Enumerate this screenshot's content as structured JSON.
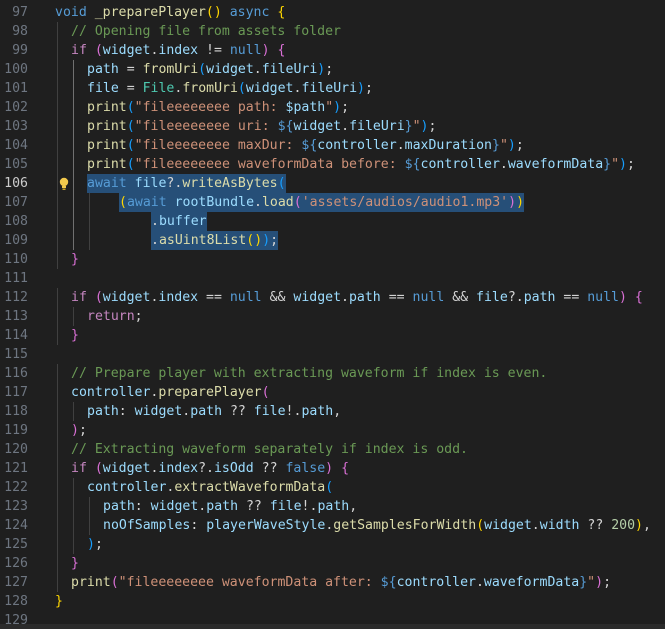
{
  "editor": {
    "language": "dart",
    "active_line": 106,
    "colors": {
      "background": "#1f1f1f",
      "selection": "#264f78",
      "keyword": "#569cd6",
      "control": "#c586c0",
      "function": "#dcdcaa",
      "variable": "#9cdcfe",
      "type": "#4ec9b0",
      "string": "#ce9178",
      "comment": "#6a9955",
      "number": "#b5cea8"
    },
    "lightbulb_icon": "lightbulb-icon",
    "lines": [
      {
        "n": "97",
        "tokens": [
          [
            "k",
            "void"
          ],
          [
            "o",
            " "
          ],
          [
            "f",
            "_preparePlayer"
          ],
          [
            "b1",
            "()"
          ],
          [
            "o",
            " "
          ],
          [
            "k",
            "async"
          ],
          [
            "o",
            " "
          ],
          [
            "b1",
            "{"
          ]
        ]
      },
      {
        "n": "98",
        "tokens": [
          [
            "m",
            "// Opening file from assets folder"
          ]
        ]
      },
      {
        "n": "99",
        "tokens": [
          [
            "c",
            "if"
          ],
          [
            "o",
            " "
          ],
          [
            "b2",
            "("
          ],
          [
            "v",
            "widget"
          ],
          [
            "o",
            "."
          ],
          [
            "v",
            "index"
          ],
          [
            "o",
            " != "
          ],
          [
            "k",
            "null"
          ],
          [
            "b2",
            ")"
          ],
          [
            "o",
            " "
          ],
          [
            "b2",
            "{"
          ]
        ]
      },
      {
        "n": "100",
        "tokens": [
          [
            "v",
            "path"
          ],
          [
            "o",
            " = "
          ],
          [
            "f",
            "fromUri"
          ],
          [
            "b3",
            "("
          ],
          [
            "v",
            "widget"
          ],
          [
            "o",
            "."
          ],
          [
            "v",
            "fileUri"
          ],
          [
            "b3",
            ")"
          ],
          [
            "o",
            ";"
          ]
        ]
      },
      {
        "n": "101",
        "tokens": [
          [
            "v",
            "file"
          ],
          [
            "o",
            " = "
          ],
          [
            "t",
            "File"
          ],
          [
            "o",
            "."
          ],
          [
            "f",
            "fromUri"
          ],
          [
            "b3",
            "("
          ],
          [
            "v",
            "widget"
          ],
          [
            "o",
            "."
          ],
          [
            "v",
            "fileUri"
          ],
          [
            "b3",
            ")"
          ],
          [
            "o",
            ";"
          ]
        ]
      },
      {
        "n": "102",
        "tokens": [
          [
            "f",
            "print"
          ],
          [
            "b3",
            "("
          ],
          [
            "s",
            "\"fileeeeeeee path: "
          ],
          [
            "v",
            "$path"
          ],
          [
            "s",
            "\""
          ],
          [
            "b3",
            ")"
          ],
          [
            "o",
            ";"
          ]
        ]
      },
      {
        "n": "103",
        "tokens": [
          [
            "f",
            "print"
          ],
          [
            "b3",
            "("
          ],
          [
            "s",
            "\"fileeeeeeee uri: "
          ],
          [
            "k",
            "${"
          ],
          [
            "v",
            "widget"
          ],
          [
            "o",
            "."
          ],
          [
            "v",
            "fileUri"
          ],
          [
            "k",
            "}"
          ],
          [
            "s",
            "\""
          ],
          [
            "b3",
            ")"
          ],
          [
            "o",
            ";"
          ]
        ]
      },
      {
        "n": "104",
        "tokens": [
          [
            "f",
            "print"
          ],
          [
            "b3",
            "("
          ],
          [
            "s",
            "\"fileeeeeeee maxDur: "
          ],
          [
            "k",
            "${"
          ],
          [
            "v",
            "controller"
          ],
          [
            "o",
            "."
          ],
          [
            "v",
            "maxDuration"
          ],
          [
            "k",
            "}"
          ],
          [
            "s",
            "\""
          ],
          [
            "b3",
            ")"
          ],
          [
            "o",
            ";"
          ]
        ]
      },
      {
        "n": "105",
        "tokens": [
          [
            "f",
            "print"
          ],
          [
            "b3",
            "("
          ],
          [
            "s",
            "\"fileeeeeeee waveformData before: "
          ],
          [
            "k",
            "${"
          ],
          [
            "v",
            "controller"
          ],
          [
            "o",
            "."
          ],
          [
            "v",
            "waveformData"
          ],
          [
            "k",
            "}"
          ],
          [
            "s",
            "\""
          ],
          [
            "b3",
            ")"
          ],
          [
            "o",
            ";"
          ]
        ]
      },
      {
        "n": "106",
        "tokens": [
          [
            "k",
            "await"
          ],
          [
            "o",
            " "
          ],
          [
            "v",
            "file"
          ],
          [
            "o",
            "?."
          ],
          [
            "f",
            "writeAsBytes"
          ],
          [
            "b3",
            "("
          ]
        ]
      },
      {
        "n": "107",
        "tokens": [
          [
            "b1",
            "("
          ],
          [
            "k",
            "await"
          ],
          [
            "o",
            " "
          ],
          [
            "v",
            "rootBundle"
          ],
          [
            "o",
            "."
          ],
          [
            "f",
            "load"
          ],
          [
            "b2",
            "("
          ],
          [
            "s",
            "'assets/audios/audio1.mp3'"
          ],
          [
            "b2",
            ")"
          ],
          [
            "b1",
            ")"
          ]
        ]
      },
      {
        "n": "108",
        "tokens": [
          [
            "o",
            "."
          ],
          [
            "v",
            "buffer"
          ]
        ]
      },
      {
        "n": "109",
        "tokens": [
          [
            "o",
            "."
          ],
          [
            "f",
            "asUint8List"
          ],
          [
            "b1",
            "()"
          ],
          [
            "b3",
            ")"
          ],
          [
            "o",
            ";"
          ]
        ]
      },
      {
        "n": "110",
        "tokens": [
          [
            "b2",
            "}"
          ]
        ]
      },
      {
        "n": "111",
        "tokens": []
      },
      {
        "n": "112",
        "tokens": [
          [
            "c",
            "if"
          ],
          [
            "o",
            " "
          ],
          [
            "b2",
            "("
          ],
          [
            "v",
            "widget"
          ],
          [
            "o",
            "."
          ],
          [
            "v",
            "index"
          ],
          [
            "o",
            " == "
          ],
          [
            "k",
            "null"
          ],
          [
            "o",
            " && "
          ],
          [
            "v",
            "widget"
          ],
          [
            "o",
            "."
          ],
          [
            "v",
            "path"
          ],
          [
            "o",
            " == "
          ],
          [
            "k",
            "null"
          ],
          [
            "o",
            " && "
          ],
          [
            "v",
            "file"
          ],
          [
            "o",
            "?."
          ],
          [
            "v",
            "path"
          ],
          [
            "o",
            " == "
          ],
          [
            "k",
            "null"
          ],
          [
            "b2",
            ")"
          ],
          [
            "o",
            " "
          ],
          [
            "b2",
            "{"
          ]
        ]
      },
      {
        "n": "113",
        "tokens": [
          [
            "c",
            "return"
          ],
          [
            "o",
            ";"
          ]
        ]
      },
      {
        "n": "114",
        "tokens": [
          [
            "b2",
            "}"
          ]
        ]
      },
      {
        "n": "115",
        "tokens": []
      },
      {
        "n": "116",
        "tokens": [
          [
            "m",
            "// Prepare player with extracting waveform if index is even."
          ]
        ]
      },
      {
        "n": "117",
        "tokens": [
          [
            "v",
            "controller"
          ],
          [
            "o",
            "."
          ],
          [
            "f",
            "preparePlayer"
          ],
          [
            "b2",
            "("
          ]
        ]
      },
      {
        "n": "118",
        "tokens": [
          [
            "v",
            "path"
          ],
          [
            "o",
            ": "
          ],
          [
            "v",
            "widget"
          ],
          [
            "o",
            "."
          ],
          [
            "v",
            "path"
          ],
          [
            "o",
            " ?? "
          ],
          [
            "v",
            "file"
          ],
          [
            "o",
            "!."
          ],
          [
            "v",
            "path"
          ],
          [
            "o",
            ","
          ]
        ]
      },
      {
        "n": "119",
        "tokens": [
          [
            "b2",
            ")"
          ],
          [
            "o",
            ";"
          ]
        ]
      },
      {
        "n": "120",
        "tokens": [
          [
            "m",
            "// Extracting waveform separately if index is odd."
          ]
        ]
      },
      {
        "n": "121",
        "tokens": [
          [
            "c",
            "if"
          ],
          [
            "o",
            " "
          ],
          [
            "b2",
            "("
          ],
          [
            "v",
            "widget"
          ],
          [
            "o",
            "."
          ],
          [
            "v",
            "index"
          ],
          [
            "o",
            "?."
          ],
          [
            "v",
            "isOdd"
          ],
          [
            "o",
            " ?? "
          ],
          [
            "k",
            "false"
          ],
          [
            "b2",
            ")"
          ],
          [
            "o",
            " "
          ],
          [
            "b2",
            "{"
          ]
        ]
      },
      {
        "n": "122",
        "tokens": [
          [
            "v",
            "controller"
          ],
          [
            "o",
            "."
          ],
          [
            "f",
            "extractWaveformData"
          ],
          [
            "b3",
            "("
          ]
        ]
      },
      {
        "n": "123",
        "tokens": [
          [
            "v",
            "path"
          ],
          [
            "o",
            ": "
          ],
          [
            "v",
            "widget"
          ],
          [
            "o",
            "."
          ],
          [
            "v",
            "path"
          ],
          [
            "o",
            " ?? "
          ],
          [
            "v",
            "file"
          ],
          [
            "o",
            "!."
          ],
          [
            "v",
            "path"
          ],
          [
            "o",
            ","
          ]
        ]
      },
      {
        "n": "124",
        "tokens": [
          [
            "v",
            "noOfSamples"
          ],
          [
            "o",
            ": "
          ],
          [
            "v",
            "playerWaveStyle"
          ],
          [
            "o",
            "."
          ],
          [
            "f",
            "getSamplesForWidth"
          ],
          [
            "b1",
            "("
          ],
          [
            "v",
            "widget"
          ],
          [
            "o",
            "."
          ],
          [
            "v",
            "width"
          ],
          [
            "o",
            " ?? "
          ],
          [
            "n",
            "200"
          ],
          [
            "b1",
            ")"
          ],
          [
            "o",
            ","
          ]
        ]
      },
      {
        "n": "125",
        "tokens": [
          [
            "b3",
            ")"
          ],
          [
            "o",
            ";"
          ]
        ]
      },
      {
        "n": "126",
        "tokens": [
          [
            "b2",
            "}"
          ]
        ]
      },
      {
        "n": "127",
        "tokens": [
          [
            "f",
            "print"
          ],
          [
            "b2",
            "("
          ],
          [
            "s",
            "\"fileeeeeeee waveformData after: "
          ],
          [
            "k",
            "${"
          ],
          [
            "v",
            "controller"
          ],
          [
            "o",
            "."
          ],
          [
            "v",
            "waveformData"
          ],
          [
            "k",
            "}"
          ],
          [
            "s",
            "\""
          ],
          [
            "b2",
            ")"
          ],
          [
            "o",
            ";"
          ]
        ]
      },
      {
        "n": "128",
        "tokens": [
          [
            "b1",
            "}"
          ]
        ]
      },
      {
        "n": "129",
        "tokens": []
      }
    ]
  }
}
